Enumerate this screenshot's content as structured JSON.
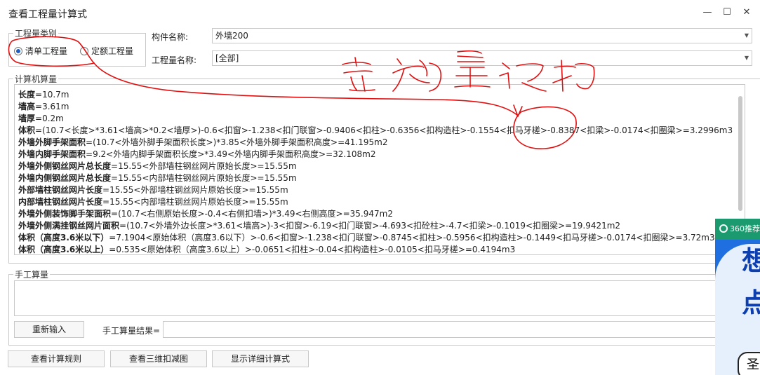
{
  "window": {
    "title": "查看工程量计算式",
    "minimize": "—",
    "maximize": "☐",
    "close": "✕"
  },
  "type_group": {
    "legend": "工程量类别",
    "radio_bill": "清单工程量",
    "radio_quota": "定额工程量",
    "selected": "bill"
  },
  "component": {
    "label": "构件名称:",
    "value": "外墙200"
  },
  "quantity_name": {
    "label": "工程量名称:",
    "value": "[全部]"
  },
  "calc": {
    "legend": "计算机算量",
    "lines": [
      {
        "k": "长度",
        "v": "=10.7m"
      },
      {
        "k": "墙高",
        "v": "=3.61m"
      },
      {
        "k": "墙厚",
        "v": "=0.2m"
      },
      {
        "k": "体积",
        "v": "=(10.7<长度>*3.61<墙高>*0.2<墙厚>)-0.6<扣窗>-1.238<扣门联窗>-0.9406<扣柱>-0.6356<扣构造柱>-0.1554<扣马牙槎>-0.8387<扣梁>-0.0174<扣圈梁>=3.2996m3"
      },
      {
        "k": "外墙外脚手架面积",
        "v": "=(10.7<外墙外脚手架面积长度>)*3.85<外墙外脚手架面积高度>=41.195m2"
      },
      {
        "k": "外墙内脚手架面积",
        "v": "=9.2<外墙内脚手架面积长度>*3.49<外墙内脚手架面积高度>=32.108m2"
      },
      {
        "k": "外墙外侧钢丝网片总长度",
        "v": "=15.55<外部墙柱钢丝网片原始长度>=15.55m"
      },
      {
        "k": "外墙内侧钢丝网片总长度",
        "v": "=15.55<内部墙柱钢丝网片原始长度>=15.55m"
      },
      {
        "k": "外部墙柱钢丝网片长度",
        "v": "=15.55<外部墙柱钢丝网片原始长度>=15.55m"
      },
      {
        "k": "内部墙柱钢丝网片长度",
        "v": "=15.55<内部墙柱钢丝网片原始长度>=15.55m"
      },
      {
        "k": "外墙外侧装饰脚手架面积",
        "v": "=(10.7<右侧原始长度>-0.4<右侧扣墙>)*3.49<右侧高度>=35.947m2"
      },
      {
        "k": "外墙外侧满挂钢丝网片面积",
        "v": "=(10.7<外墙外边长度>*3.61<墙高>)-3<扣窗>-6.19<扣门联窗>-4.693<扣砼柱>-4.7<扣梁>-0.1019<扣圈梁>=19.9421m2"
      },
      {
        "k": "体积（高度3.6米以下）",
        "v": "=7.1904<原始体积（高度3.6以下）>-0.6<扣窗>-1.238<扣门联窗>-0.8745<扣柱>-0.5956<扣构造柱>-0.1449<扣马牙槎>-0.0174<扣圈梁>=3.72m3"
      },
      {
        "k": "体积（高度3.6米以上）",
        "v": "=0.535<原始体积（高度3.6以上）>-0.0651<扣柱>-0.04<扣构造柱>-0.0105<扣马牙槎>=0.4194m3"
      }
    ]
  },
  "manual": {
    "legend": "手工算量",
    "reenter": "重新输入",
    "result_label": "手工算量结果="
  },
  "bottom": {
    "rules": "查看计算规则",
    "view3d": "查看三维扣减图",
    "detail": "显示详细计算式"
  },
  "side_ad": {
    "head": "360推荐",
    "big1": "想",
    "big2": "点",
    "pill": "圣"
  },
  "colors": {
    "accent": "#1f5fbf",
    "annotation": "#e01010",
    "ad_blue": "#1f6fe0",
    "ad_green": "#1a9a6e"
  }
}
